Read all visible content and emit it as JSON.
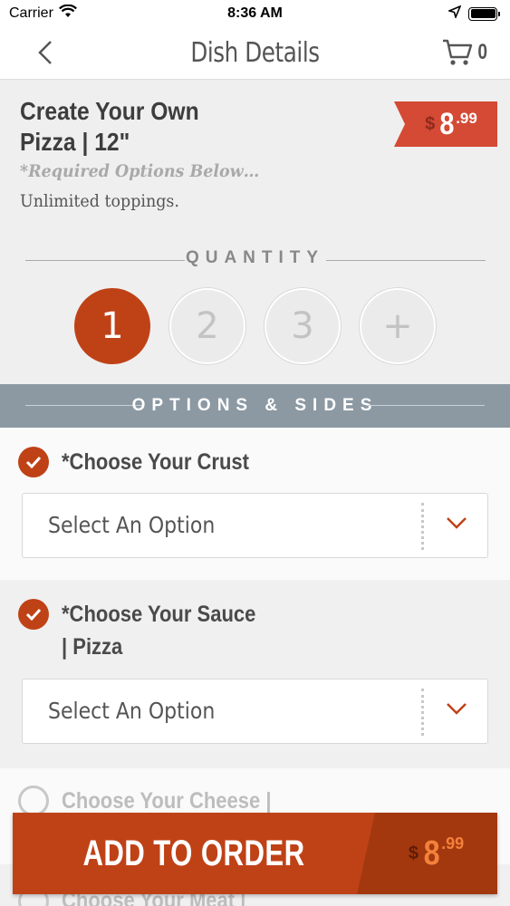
{
  "status_bar": {
    "carrier": "Carrier",
    "time": "8:36 AM"
  },
  "nav": {
    "title": "Dish Details",
    "cart_count": "0"
  },
  "dish": {
    "name_line1": "Create Your Own",
    "name_line2": "Pizza | 12\"",
    "price_symbol": "$",
    "price_main": "8",
    "price_cents": ".99",
    "required_note": "*Required Options Below…",
    "description": "Unlimited toppings."
  },
  "quantity": {
    "label": "QUANTITY",
    "options": [
      "1",
      "2",
      "3",
      "+"
    ],
    "selected": "1"
  },
  "options_header": "OPTIONS & SIDES",
  "options": [
    {
      "title": "*Choose Your Crust",
      "checked": true,
      "select_placeholder": "Select An Option"
    },
    {
      "title_line1": "*Choose Your Sauce",
      "title_line2": "| Pizza",
      "checked": true,
      "select_placeholder": "Select An Option"
    },
    {
      "title": "Choose Your Cheese |",
      "checked": false
    },
    {
      "title": "Choose Your Meat |",
      "checked": false
    }
  ],
  "add_to_order": {
    "label": "ADD TO ORDER",
    "price_symbol": "$",
    "price_main": "8",
    "price_cents": ".99"
  },
  "colors": {
    "accent": "#bf4217",
    "price_tag": "#d44a35",
    "options_header": "#8c99a3"
  }
}
